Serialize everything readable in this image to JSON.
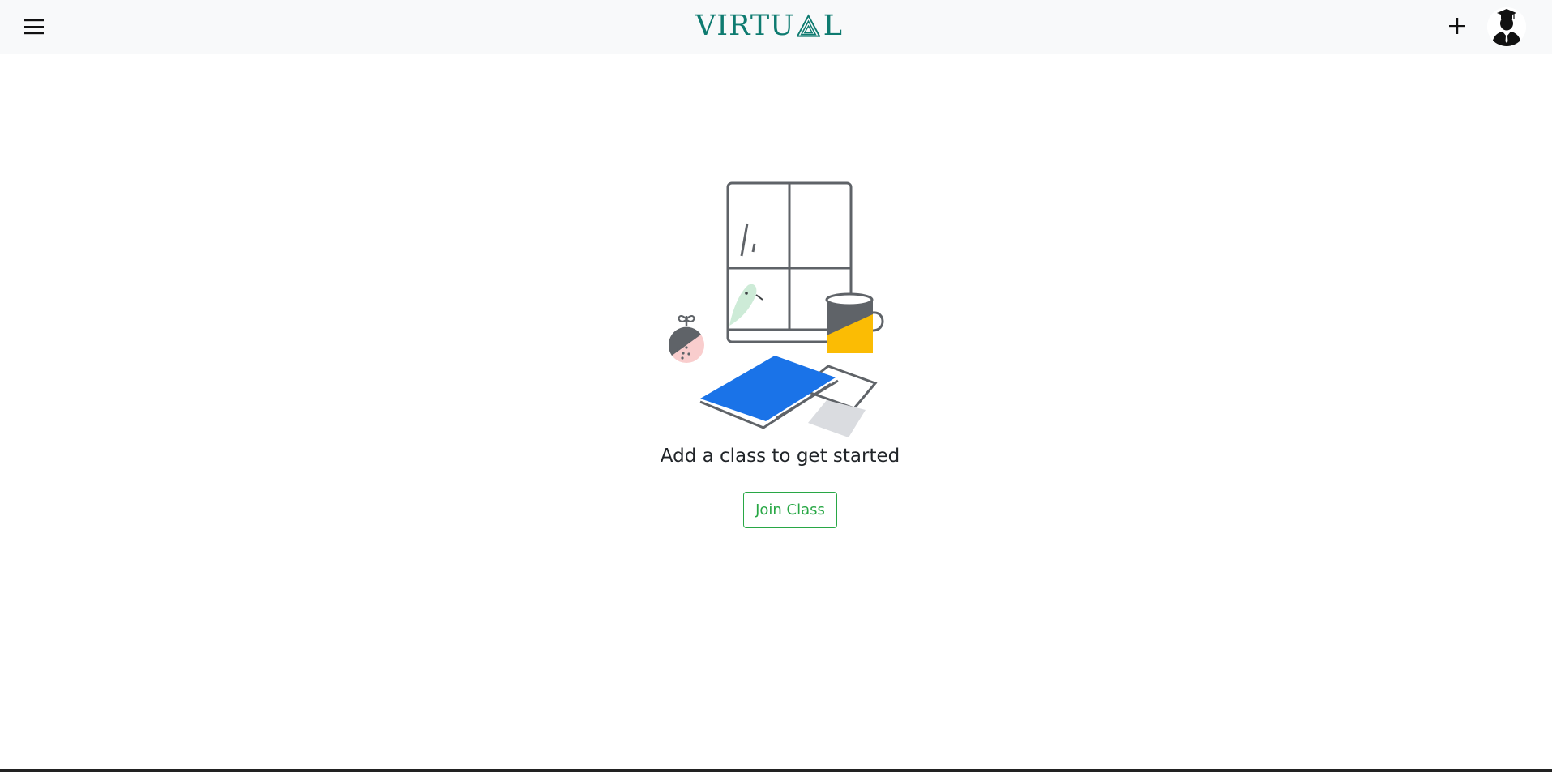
{
  "navbar": {
    "menu_icon": "hamburger-menu-icon",
    "brand": {
      "text_before": "VIRTU",
      "logo_letter_icon": "triangle-a-logo",
      "text_after": "L",
      "color": "#0e7b70"
    },
    "add_icon": "plus-icon",
    "avatar_icon": "graduate-avatar-icon"
  },
  "main": {
    "empty_state_icon": "desk-window-illustration",
    "message": "Add a class to get started",
    "join_button_label": "Join Class"
  },
  "colors": {
    "navbar_bg": "#f8f9fa",
    "brand": "#0e7b70",
    "button_green": "#28a745",
    "book_blue": "#1a73e8",
    "mug_yellow": "#fbbc04"
  }
}
